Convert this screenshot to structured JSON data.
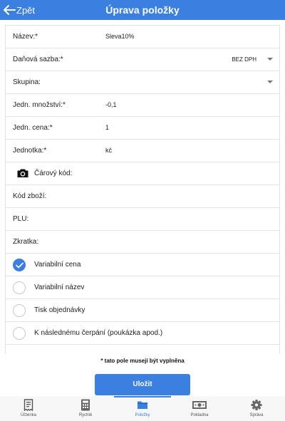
{
  "header": {
    "back_label": "Zpět",
    "title": "Úprava položky"
  },
  "form": {
    "name": {
      "label": "Název:*",
      "value": "Sleva10%"
    },
    "tax_rate": {
      "label": "Daňová sazba:*",
      "value": "BEZ DPH"
    },
    "group": {
      "label": "Skupina:"
    },
    "unit_quantity": {
      "label": "Jedn. množství:*",
      "value": "-0,1"
    },
    "unit_price": {
      "label": "Jedn. cena:*",
      "value": "1"
    },
    "unit": {
      "label": "Jednotka:*",
      "value": "kč"
    },
    "barcode": {
      "label": "Čárový kód:"
    },
    "item_code": {
      "label": "Kód zboží:"
    },
    "plu": {
      "label": "PLU:"
    },
    "shortcut": {
      "label": "Zkratka:"
    },
    "options": [
      {
        "label": "Variabilní cena",
        "checked": true
      },
      {
        "label": "Variabilní název",
        "checked": false
      },
      {
        "label": "Tisk objednávky",
        "checked": false
      },
      {
        "label": "K následnému čerpání (poukázka apod.)",
        "checked": false
      }
    ]
  },
  "required_note": "* tato pole musejí být vyplněna",
  "save_label": "Uložit",
  "tabs": [
    {
      "label": "Účtenka",
      "icon": "receipt-icon"
    },
    {
      "label": "Rychlé",
      "icon": "calculator-icon"
    },
    {
      "label": "Položky",
      "icon": "folder-icon",
      "active": true
    },
    {
      "label": "Pokladna",
      "icon": "cash-icon"
    },
    {
      "label": "Správa",
      "icon": "gear-icon"
    }
  ],
  "colors": {
    "accent": "#3b7fe0",
    "border": "#e2e2e2"
  }
}
